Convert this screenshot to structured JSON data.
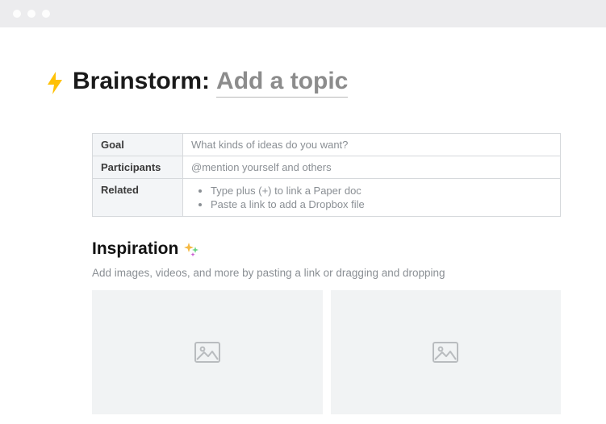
{
  "title": {
    "prefix": "Brainstorm:",
    "topic_placeholder": "Add a topic"
  },
  "meta": {
    "rows": [
      {
        "label": "Goal",
        "placeholder": "What kinds of ideas do you want?"
      },
      {
        "label": "Participants",
        "placeholder": "@mention yourself and others"
      },
      {
        "label": "Related",
        "bullets": [
          "Type plus (+) to link a Paper doc",
          "Paste a link to add a Dropbox file"
        ]
      }
    ]
  },
  "inspiration": {
    "heading": "Inspiration",
    "sub": "Add images, videos, and more by pasting a link or dragging and dropping"
  },
  "icons": {
    "bolt": "lightning-bolt-icon",
    "sparkle": "sparkle-icon",
    "image_placeholder": "image-placeholder-icon"
  }
}
